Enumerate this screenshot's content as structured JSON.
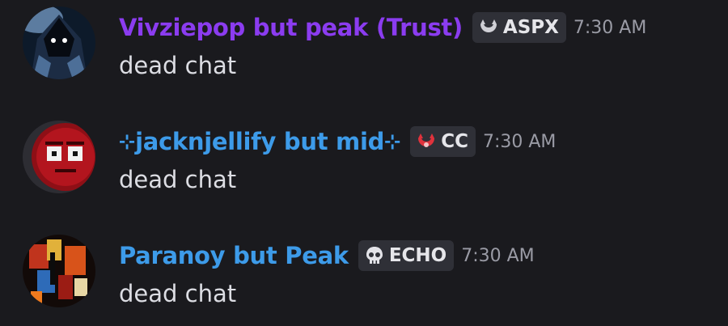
{
  "messages": [
    {
      "author": "Vivziepop but peak (Trust)",
      "author_color": "#8b3cf0",
      "tag": {
        "label": "ASPX",
        "icon": "gray-crescent-icon"
      },
      "timestamp": "7:30 AM",
      "text": "dead chat"
    },
    {
      "author": "jacknjellify but mid",
      "author_color": "#3d9be9",
      "name_decoration": "⊹",
      "tag": {
        "label": "CC",
        "icon": "red-crescent-icon"
      },
      "timestamp": "7:30 AM",
      "text": "dead chat"
    },
    {
      "author": "Paranoy but Peak",
      "author_color": "#3d9be9",
      "tag": {
        "label": "ECHO",
        "icon": "skull-icon"
      },
      "timestamp": "7:30 AM",
      "text": "dead chat"
    }
  ]
}
